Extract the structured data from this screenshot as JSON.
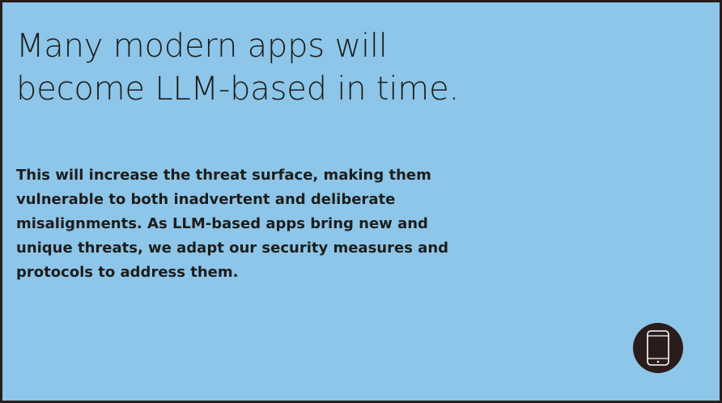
{
  "headline": {
    "lines": [
      "Many modern apps will",
      "become LLM-based in time."
    ]
  },
  "body": {
    "lines": [
      "This will increase the threat surface, making them",
      "vulnerable to both inadvertent and deliberate",
      "misalignments. As LLM-based apps bring new and",
      "unique threats, we adapt our security measures and",
      "protocols to address them."
    ]
  },
  "icon": {
    "name": "mobile-phone-icon"
  },
  "colors": {
    "frame": "#2a1c1c",
    "background": "#8dc6e8",
    "text": "#1d1d1d",
    "icon_stroke": "#ffffff"
  }
}
